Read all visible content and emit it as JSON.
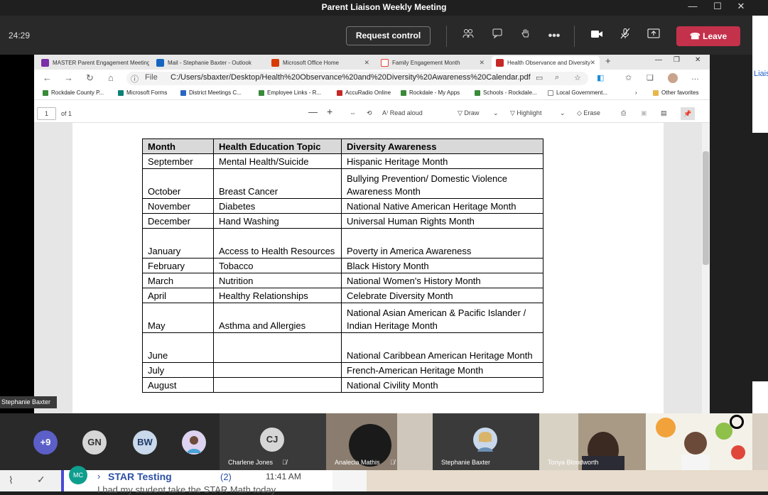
{
  "window": {
    "title": "Parent Liaison Weekly Meeting",
    "controls": [
      "—",
      "☐",
      "✕"
    ]
  },
  "meeting": {
    "timer": "24:29",
    "request_control": "Request control",
    "leave": "Leave",
    "leave_color": "#c4314b"
  },
  "browser": {
    "tabs": [
      {
        "label": "MASTER Parent Engagement Meeting",
        "icon": "onenote-icon",
        "color": "#7b2da8"
      },
      {
        "label": "Mail - Stephanie Baxter - Outlook",
        "icon": "outlook-icon",
        "color": "#1565c0"
      },
      {
        "label": "Microsoft Office Home",
        "icon": "office-icon",
        "color": "#d83b01"
      },
      {
        "label": "Family Engagement Month",
        "icon": "google-icon",
        "color": "#ea4335"
      },
      {
        "label": "Health Observance and Diversity",
        "icon": "pdf-icon",
        "color": "#c62828"
      }
    ],
    "file_label": "File",
    "url": "C:/Users/sbaxter/Desktop/Health%20Observance%20and%20Diversity%20Awareness%20Calendar.pdf",
    "favorites": [
      "Rockdale County P...",
      "Microsoft Forms",
      "District Meetings C...",
      "Employee Links - R...",
      "AccuRadio Online",
      "Rockdale - My Apps",
      "Schools - Rockdale...",
      "Local Government..."
    ],
    "other_favorites": "Other favorites"
  },
  "pdf_toolbar": {
    "page": "1",
    "of": "of 1",
    "read_aloud": "Read aloud",
    "draw": "Draw",
    "highlight": "Highlight",
    "erase": "Erase"
  },
  "calendar": {
    "headers": [
      "Month",
      "Health Education Topic",
      "Diversity Awareness"
    ],
    "rows": [
      [
        "September",
        "Mental Health/Suicide",
        "Hispanic Heritage Month"
      ],
      [
        "October",
        "Breast Cancer",
        "Bullying Prevention/ Domestic Violence Awareness Month"
      ],
      [
        "November",
        "Diabetes",
        "National Native American Heritage Month"
      ],
      [
        "December",
        "Hand Washing",
        "Universal Human Rights Month"
      ],
      [
        "January",
        "Access to Health Resources",
        "Poverty in America Awareness"
      ],
      [
        "February",
        "Tobacco",
        "Black History Month"
      ],
      [
        "March",
        "Nutrition",
        "National Women's History Month"
      ],
      [
        "April",
        "Healthy Relationships",
        "Celebrate Diversity Month"
      ],
      [
        "May",
        "Asthma and Allergies",
        "National Asian American & Pacific Islander / Indian Heritage Month"
      ],
      [
        "June",
        "",
        "National Caribbean American Heritage Month"
      ],
      [
        "July",
        "",
        "French-American Heritage Month"
      ],
      [
        "August",
        "",
        "National Civility Month"
      ]
    ]
  },
  "presenter_tag": "Stephanie Baxter",
  "right_edge_text": "Liais",
  "participants": {
    "overflow": "+9",
    "avatars": [
      {
        "initials": "GN"
      },
      {
        "initials": "BW"
      }
    ],
    "tiles": [
      {
        "name": "Charlene Jones",
        "initials": "CJ"
      },
      {
        "name": "Analecia Mathis"
      },
      {
        "name": "Stephanie Baxter"
      },
      {
        "name": "Tonya Bloodworth"
      }
    ]
  },
  "chat": {
    "avatar": "MC",
    "title": "STAR Testing",
    "count": "(2)",
    "time": "11:41 AM",
    "preview": "I had my student take the STAR Math today"
  }
}
